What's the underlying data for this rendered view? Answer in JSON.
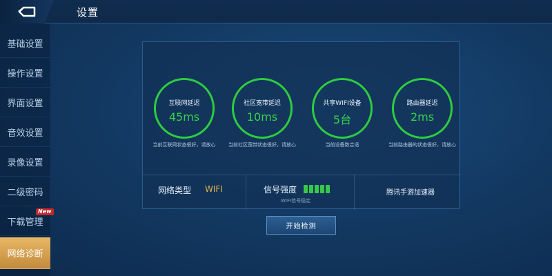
{
  "header": {
    "title": "设置"
  },
  "sidebar": {
    "items": [
      {
        "label": "基础设置",
        "active": false
      },
      {
        "label": "操作设置",
        "active": false
      },
      {
        "label": "界面设置",
        "active": false
      },
      {
        "label": "音效设置",
        "active": false
      },
      {
        "label": "录像设置",
        "active": false
      },
      {
        "label": "二级密码",
        "active": false
      },
      {
        "label": "下载管理",
        "active": false
      },
      {
        "label": "网络诊断",
        "active": true
      }
    ],
    "new_badge": "New"
  },
  "diagnostics": {
    "gauges": [
      {
        "label": "互联网延迟",
        "value": "45ms",
        "desc": "当前互联网状态很好，请放心"
      },
      {
        "label": "社区宽带延迟",
        "value": "10ms",
        "desc": "当前社区宽带状态很好，请放心"
      },
      {
        "label": "共享WIFI设备",
        "value": "5台",
        "desc": "当前设备数合适"
      },
      {
        "label": "路由器延迟",
        "value": "2ms",
        "desc": "当前路由器的状态很好，请放心"
      }
    ],
    "network_type_label": "网络类型",
    "network_type_value": "WIFI",
    "signal_label": "信号强度",
    "signal_level": 5,
    "signal_sub": "WIFI信号稳定",
    "accelerator_label": "腾讯手游加速器"
  },
  "actions": {
    "start_label": "开始检测"
  },
  "colors": {
    "accent_green": "#36d24a",
    "accent_gold": "#e5b54a",
    "active_tab": "#d9a553"
  },
  "icons": {
    "back": "back-arrow-icon"
  }
}
